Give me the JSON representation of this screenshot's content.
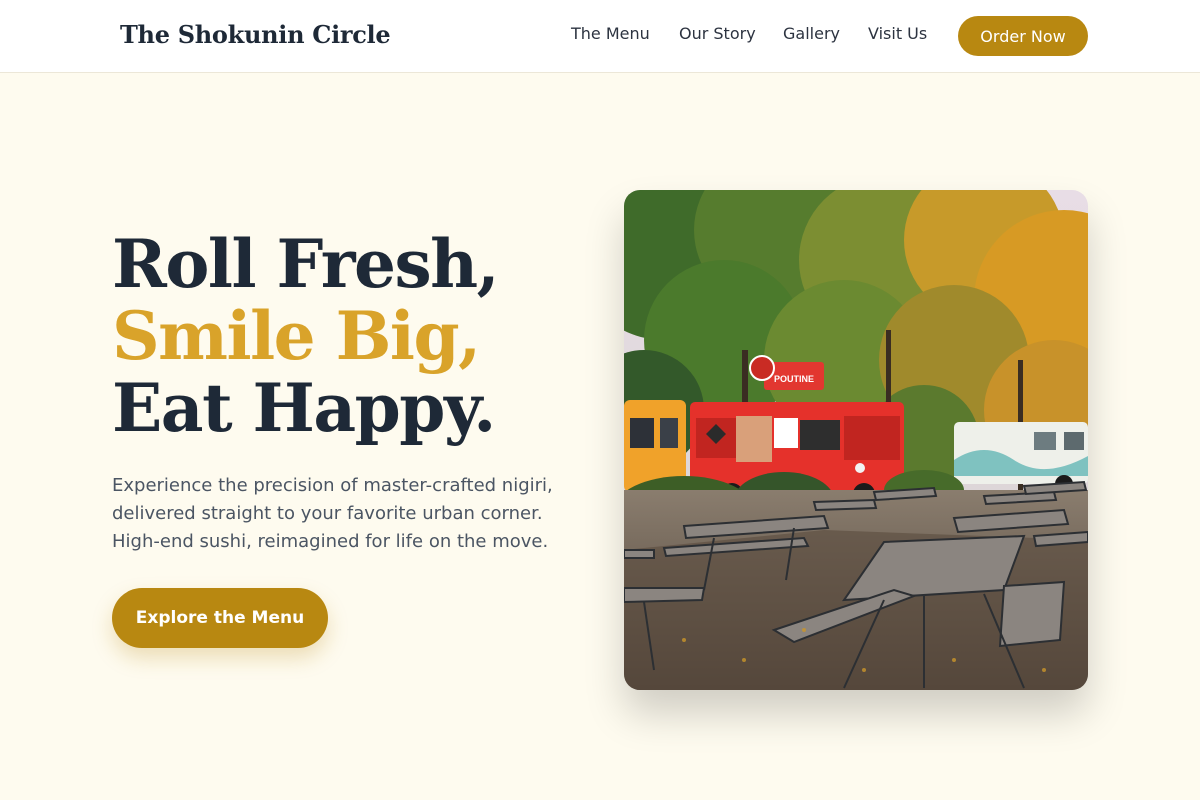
{
  "header": {
    "brand": "The Shokunin Circle",
    "nav": [
      "The Menu",
      "Our Story",
      "Gallery",
      "Visit Us"
    ],
    "order_button": "Order Now"
  },
  "hero": {
    "headline": [
      "Roll Fresh,",
      "Smile Big,",
      "Eat Happy."
    ],
    "subcopy": [
      "Experience the precision of master-crafted nigiri,",
      "delivered straight to your favorite urban corner.",
      "High-end sushi, reimagined for life on the move."
    ],
    "cta": "Explore the Menu"
  },
  "photo": {
    "truck_sign": "POUTINE"
  },
  "colors": {
    "background": "#fefbef",
    "accent_gold": "#b88811",
    "headline_accent": "#d9a32a",
    "text_dark": "#1e2937"
  }
}
